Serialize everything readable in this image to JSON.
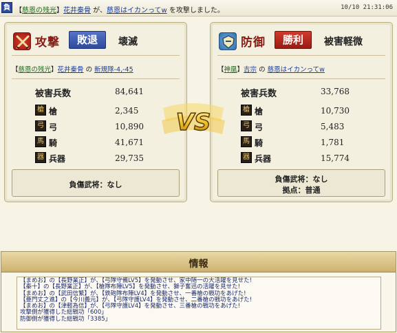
{
  "banner": {
    "result_badge": "負",
    "prefix": "【",
    "alliance": "慈恩の残光",
    "close": "】",
    "player": "花井秦骨",
    "mid": " が、",
    "target": "慈恩はイカンってw",
    "suffix": " を攻撃しました。",
    "timestamp": "10/10 21:31:06"
  },
  "attack": {
    "role": "攻撃",
    "badge": "敗退",
    "outcome": "壊滅",
    "party": {
      "open": "【",
      "alliance": "慈恩の残光",
      "close": "】",
      "player": "花井秦骨",
      "sep": " の ",
      "unit": "新規隊-4,-45"
    },
    "loss_title": "被害兵数",
    "loss_total": "84,641",
    "units": [
      {
        "icon": "spear-icon",
        "glyph": "槍",
        "name": "槍",
        "value": "2,345"
      },
      {
        "icon": "bow-icon",
        "glyph": "弓",
        "name": "弓",
        "value": "10,890"
      },
      {
        "icon": "horse-icon",
        "glyph": "馬",
        "name": "騎",
        "value": "41,671"
      },
      {
        "icon": "siege-icon",
        "glyph": "器",
        "name": "兵器",
        "value": "29,735"
      }
    ],
    "wounded": "負傷武将：なし"
  },
  "defense": {
    "role": "防御",
    "badge": "勝利",
    "outcome": "被害軽微",
    "party": {
      "open": "【",
      "alliance": "神凰",
      "close": "】",
      "player": "吉宗",
      "sep": " の ",
      "unit": "慈恩はイカンってw"
    },
    "loss_title": "被害兵数",
    "loss_total": "33,768",
    "units": [
      {
        "icon": "spear-icon",
        "glyph": "槍",
        "name": "槍",
        "value": "10,730"
      },
      {
        "icon": "bow-icon",
        "glyph": "弓",
        "name": "弓",
        "value": "5,483"
      },
      {
        "icon": "horse-icon",
        "glyph": "馬",
        "name": "騎",
        "value": "1,781"
      },
      {
        "icon": "siege-icon",
        "glyph": "器",
        "name": "兵器",
        "value": "15,774"
      }
    ],
    "wounded": "負傷武将：なし",
    "stronghold": "拠点：普通"
  },
  "vs_label": "VS",
  "info": {
    "title": "情報",
    "lines": [
      "【まめお】の【長野業正】が、【弓隊守備LV5】を発動させ、家中随一の大活躍を見せた!",
      "【秦十】の【長野業正】が、【槍隊布陣LV5】を発動させ、獅子奮迅の活躍を見せた!",
      "【まめお】の【武田信繁】が、【鉄砲隊布陣LV4】を発動させ、一番槍の戦功をあげた!",
      "【亜門丈之進】の【今川義元】が、【弓隊守護LV4】を発動させ、二番槍の戦功をあげた!",
      "【まめお】の【津軽為信】が、【弓隊守護LV4】を発動させ、三番槍の戦功をあげた!",
      "攻撃側が獲得した総戦功「600」",
      "防御側が獲得した総戦功「3385」"
    ]
  }
}
